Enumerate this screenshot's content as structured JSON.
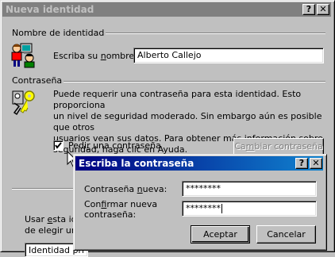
{
  "main_window": {
    "title": "Nueva identidad",
    "help_button": "?",
    "close_button": "✕",
    "name_group": {
      "label": "Nombre de identidad",
      "field_label_prefix": "Escriba su ",
      "field_label_accel": "n",
      "field_label_suffix": "ombre:",
      "name_value": "Alberto Callejo"
    },
    "password_group": {
      "label": "Contraseña",
      "description": [
        "Puede requerir una contraseña para esta identidad.  Esto proporciona",
        "un nivel de seguridad moderado. Sin embargo aún es posible que otros",
        "usuarios vean sus datos. Para obtener más información sobre",
        "seguridad, haga clic en Ayuda."
      ],
      "checkbox_prefix": "Pedi",
      "checkbox_accel": "r",
      "checkbox_suffix": " una contraseña",
      "checkbox_checked": true,
      "change_prefix": "Ca",
      "change_accel": "m",
      "change_suffix": "biar contraseña"
    },
    "partial_texts": {
      "line1_prefix": "Usar ",
      "line1_accel": "e",
      "line1_suffix": "sta identidad",
      "line2": "de elegir una",
      "field_text": "Identidad pri"
    }
  },
  "password_dialog": {
    "title": "Escriba la contraseña",
    "help_button": "?",
    "close_button": "✕",
    "new_label_prefix": "Contraseña ",
    "new_label_accel": "n",
    "new_label_suffix": "ueva:",
    "new_value": "********",
    "confirm_label_line1_prefix": "Con",
    "confirm_label_line1_accel": "f",
    "confirm_label_line1_suffix": "irmar nueva",
    "confirm_label_line2": "contraseña:",
    "confirm_value": "********",
    "ok_label": "Aceptar",
    "cancel_label": "Cancelar"
  }
}
